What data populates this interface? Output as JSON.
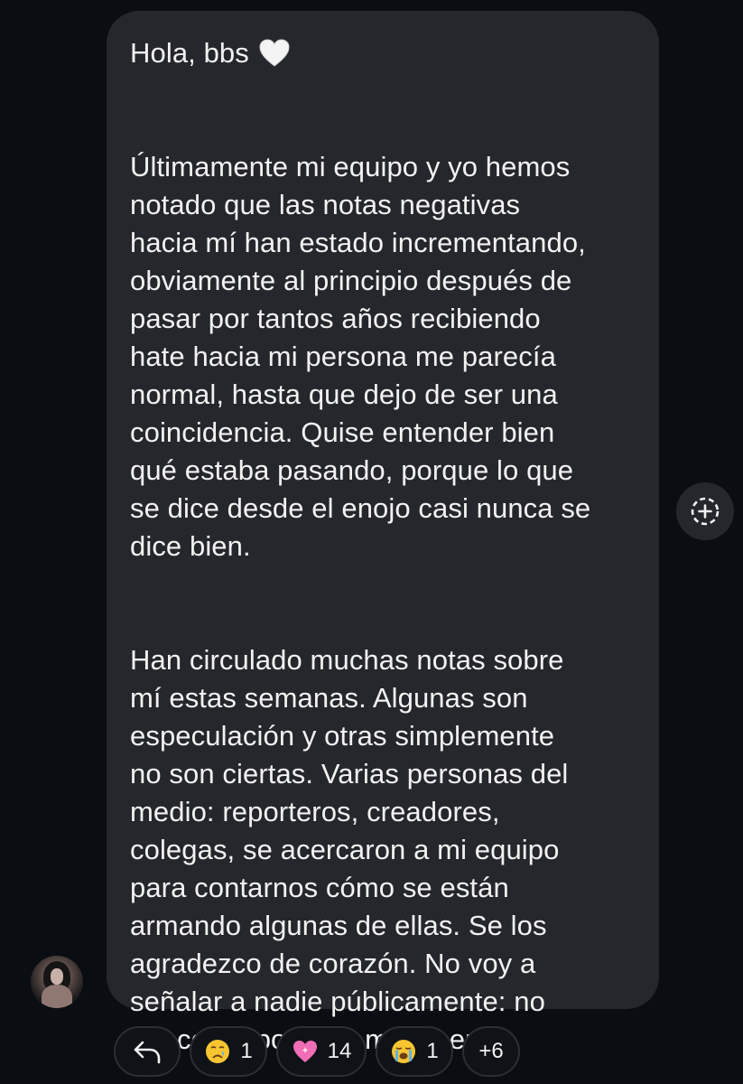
{
  "message": {
    "greeting": "Hola, bbs",
    "greeting_emoji": "white-heart-icon",
    "paragraph1": "Últimamente mi equipo y yo hemos\nnotado que las notas negativas\nhacia mí han estado incrementando,\nobviamente al principio después de\npasar por tantos años recibiendo\nhate hacia mi persona me parecía\nnormal, hasta que dejo de ser una\ncoincidencia. Quise entender bien\nqué estaba pasando, porque lo que\nse dice desde el enojo casi nunca se\ndice bien.",
    "paragraph2": "Han circulado muchas notas sobre\nmí estas semanas. Algunas son\nespeculación y otras simplemente\nno son ciertas. Varias personas del\nmedio: reporteros, creadores,\ncolegas, se acercaron a mi equipo\npara contarnos cómo se están\narmando algunas de ellas. Se los\nagradezco de corazón. No voy a\nseñalar a nadie públicamente: no\nme corresponde a mí hacerlo."
  },
  "reactions": {
    "reply_icon": "reply-arrow-icon",
    "items": [
      {
        "emoji": "crying-face",
        "count": "1"
      },
      {
        "emoji": "sparkling-heart",
        "count": "14"
      },
      {
        "emoji": "loudly-crying-face",
        "count": "1"
      }
    ],
    "more": "+6"
  },
  "colors": {
    "background": "#0a0d12",
    "bubble": "#25272c",
    "text": "#f2f2f2"
  }
}
